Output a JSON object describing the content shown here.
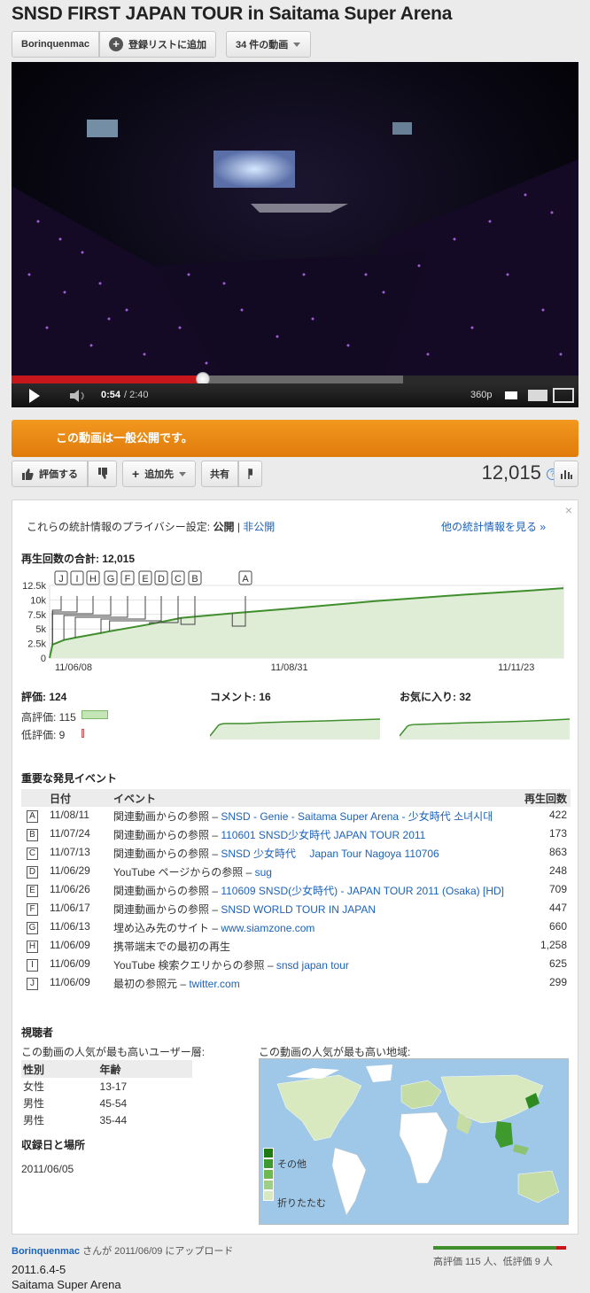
{
  "title": "SNSD FIRST JAPAN TOUR in Saitama Super Arena",
  "header": {
    "channel": "Borinquenmac",
    "subscribe_label": "登録リストに追加",
    "videos_label": "34 件の動画"
  },
  "player": {
    "time_current": "0:54",
    "time_total": "/ 2:40",
    "quality": "360p",
    "progress_fraction": 0.3375,
    "loaded_fraction": 0.69
  },
  "public_notice": "この動画は一般公開です。",
  "actions": {
    "like_label": "評価する",
    "add_label": "追加先",
    "share_label": "共有",
    "views": "12,015"
  },
  "stats": {
    "privacy_prefix": "これらの統計情報のプライバシー設定:",
    "privacy_public": "公開",
    "privacy_sep": "|",
    "privacy_private": "非公開",
    "more_stats": "他の統計情報を見る »",
    "total_views_label": "再生回数の合計: 12,015",
    "ratings_label": "評価: 124",
    "likes_label": "高評価: 115",
    "dislikes_label": "低評価: 9",
    "comments_label": "コメント: 16",
    "favorites_label": "お気に入り: 32",
    "events_heading": "重要な発見イベント",
    "events_headers": [
      "日付",
      "イベント",
      "再生回数"
    ],
    "events": [
      {
        "letter": "A",
        "date": "11/08/11",
        "prefix": "関連動画からの参照 – ",
        "link": "SNSD - Genie - Saitama Super Arena - 少女時代 소녀시대",
        "count": "422"
      },
      {
        "letter": "B",
        "date": "11/07/24",
        "prefix": "関連動画からの参照 – ",
        "link": "110601 SNSD少女時代 JAPAN TOUR 2011",
        "count": "173"
      },
      {
        "letter": "C",
        "date": "11/07/13",
        "prefix": "関連動画からの参照 – ",
        "link": "SNSD 少女時代　 Japan Tour Nagoya 110706",
        "count": "863"
      },
      {
        "letter": "D",
        "date": "11/06/29",
        "prefix": "YouTube ページからの参照 – ",
        "link": "sug",
        "count": "248"
      },
      {
        "letter": "E",
        "date": "11/06/26",
        "prefix": "関連動画からの参照 – ",
        "link": "110609 SNSD(少女時代) - JAPAN TOUR 2011 (Osaka) [HD]",
        "count": "709"
      },
      {
        "letter": "F",
        "date": "11/06/17",
        "prefix": "関連動画からの参照 – ",
        "link": "SNSD WORLD TOUR IN JAPAN",
        "count": "447"
      },
      {
        "letter": "G",
        "date": "11/06/13",
        "prefix": "埋め込み先のサイト – ",
        "link": "www.siamzone.com",
        "count": "660"
      },
      {
        "letter": "H",
        "date": "11/06/09",
        "prefix": "携帯端末での最初の再生",
        "link": "",
        "count": "1,258"
      },
      {
        "letter": "I",
        "date": "11/06/09",
        "prefix": "YouTube 検索クエリからの参照 – ",
        "link": "snsd japan tour",
        "count": "625"
      },
      {
        "letter": "J",
        "date": "11/06/09",
        "prefix": "最初の参照元 – ",
        "link": "twitter.com",
        "count": "299"
      }
    ],
    "audience_heading": "視聴者",
    "demo_caption": "この動画の人気が最も高いユーザー層:",
    "demo_headers": [
      "性別",
      "年齢"
    ],
    "demographics": [
      {
        "gender": "女性",
        "age": "13-17"
      },
      {
        "gender": "男性",
        "age": "45-54"
      },
      {
        "gender": "男性",
        "age": "35-44"
      }
    ],
    "region_caption": "この動画の人気が最も高い地域:",
    "legend_top": "その他",
    "legend_bottom": "折りたたむ",
    "recorded_heading": "収録日と場所",
    "recorded_date": "2011/06/05"
  },
  "chart_data": {
    "type": "area",
    "title": "",
    "xlabel": "",
    "ylabel": "",
    "x_tick_labels": [
      "11/06/08",
      "11/08/31",
      "11/11/23"
    ],
    "y_tick_labels": [
      "0",
      "2.5k",
      "5k",
      "7.5k",
      "10k",
      "12.5k"
    ],
    "ylim": [
      0,
      12500
    ],
    "x": [
      "11/06/08",
      "11/06/09",
      "11/06/13",
      "11/06/17",
      "11/06/26",
      "11/06/29",
      "11/07/13",
      "11/07/24",
      "11/08/11",
      "11/08/31",
      "11/09/30",
      "11/10/31",
      "11/11/23",
      "11/12/05"
    ],
    "values": [
      0,
      2300,
      3100,
      3500,
      4300,
      4600,
      5800,
      6900,
      7700,
      8500,
      9800,
      10900,
      11600,
      12015
    ],
    "event_markers": [
      {
        "label": "J",
        "x": "11/06/09"
      },
      {
        "label": "I",
        "x": "11/06/09"
      },
      {
        "label": "H",
        "x": "11/06/09"
      },
      {
        "label": "G",
        "x": "11/06/13"
      },
      {
        "label": "F",
        "x": "11/06/17"
      },
      {
        "label": "E",
        "x": "11/06/26"
      },
      {
        "label": "D",
        "x": "11/06/29"
      },
      {
        "label": "C",
        "x": "11/07/13"
      },
      {
        "label": "B",
        "x": "11/07/24"
      },
      {
        "label": "A",
        "x": "11/08/11"
      }
    ],
    "grid": true,
    "color": "#3f8f2d"
  },
  "footer": {
    "uploader": "Borinquenmac",
    "upload_text": "さんが 2011/06/09 にアップロード",
    "desc_line1": "2011.6.4-5",
    "desc_line2": "Saitama Super Arena",
    "like_summary": "高評価 115 人、低評価 9 人",
    "like_fraction": 0.927
  }
}
